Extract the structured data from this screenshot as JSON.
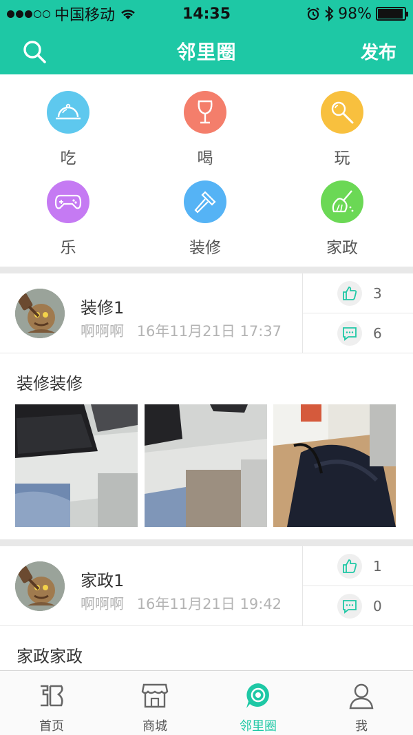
{
  "status_bar": {
    "carrier": "中国移动",
    "time": "14:35",
    "battery": "98%",
    "battery_level": 0.98
  },
  "nav": {
    "title": "邻里圈",
    "publish_label": "发布",
    "search_icon": "search-icon"
  },
  "categories": [
    {
      "label": "吃",
      "icon": "cloche-icon",
      "color": "#5ec8ee"
    },
    {
      "label": "喝",
      "icon": "wine-glass-icon",
      "color": "#f47e6b"
    },
    {
      "label": "玩",
      "icon": "magnifier-icon",
      "color": "#f8c03e"
    },
    {
      "label": "乐",
      "icon": "gamepad-icon",
      "color": "#c57af3"
    },
    {
      "label": "装修",
      "icon": "hammer-icon",
      "color": "#55b3f5"
    },
    {
      "label": "家政",
      "icon": "broom-icon",
      "color": "#6bd855"
    }
  ],
  "posts": [
    {
      "title": "装修1",
      "author": "啊啊啊",
      "time": "16年11月21日 17:37",
      "likes": "3",
      "comments": "6",
      "content": "装修装修"
    },
    {
      "title": "家政1",
      "author": "啊啊啊",
      "time": "16年11月21日 19:42",
      "likes": "1",
      "comments": "0",
      "content": "家政家政"
    }
  ],
  "tabs": [
    {
      "label": "首页",
      "icon": "home-logo-icon"
    },
    {
      "label": "商城",
      "icon": "store-icon"
    },
    {
      "label": "邻里圈",
      "icon": "neighborhood-circle-icon"
    },
    {
      "label": "我",
      "icon": "user-icon"
    }
  ],
  "colors": {
    "accent": "#1ec8a5",
    "divider": "#e8e8e8",
    "meta_text": "#b3b3b3"
  }
}
